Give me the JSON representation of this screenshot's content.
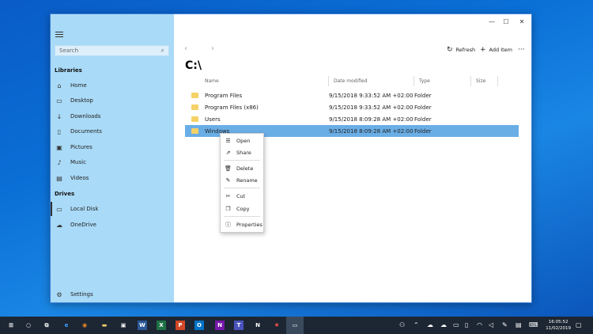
{
  "sidebar": {
    "search_placeholder": "Search",
    "libraries_title": "Libraries",
    "libraries": [
      {
        "label": "Home",
        "icon": "home-icon"
      },
      {
        "label": "Desktop",
        "icon": "desktop-icon"
      },
      {
        "label": "Downloads",
        "icon": "download-icon"
      },
      {
        "label": "Documents",
        "icon": "document-icon"
      },
      {
        "label": "Pictures",
        "icon": "pictures-icon"
      },
      {
        "label": "Music",
        "icon": "music-icon"
      },
      {
        "label": "Videos",
        "icon": "video-icon"
      }
    ],
    "drives_title": "Drives",
    "drives": [
      {
        "label": "Local Disk",
        "icon": "disk-icon"
      },
      {
        "label": "OneDrive",
        "icon": "cloud-icon"
      }
    ],
    "settings_label": "Settings"
  },
  "toolbar": {
    "refresh_label": "Refresh",
    "add_item_label": "Add Item"
  },
  "path": "C:\\",
  "columns": {
    "name": "Name",
    "date": "Date modified",
    "type": "Type",
    "size": "Size"
  },
  "files": [
    {
      "name": "Program Files",
      "date": "9/15/2018 9:33:52 AM +02:00",
      "type": "Folder"
    },
    {
      "name": "Program Files (x86)",
      "date": "9/15/2018 9:33:52 AM +02:00",
      "type": "Folder"
    },
    {
      "name": "Users",
      "date": "9/15/2018 8:09:28 AM +02:00",
      "type": "Folder"
    },
    {
      "name": "Windows",
      "date": "9/15/2018 8:09:28 AM +02:00",
      "type": "Folder"
    }
  ],
  "context_menu": {
    "open": "Open",
    "share": "Share",
    "delete": "Delete",
    "rename": "Rename",
    "cut": "Cut",
    "copy": "Copy",
    "properties": "Properties"
  },
  "taskbar": {
    "time": "16:05:52",
    "date": "11/02/2019"
  },
  "colors": {
    "sidebar": "#a9daf7",
    "selection": "#6aaee6",
    "taskbar": "#1d2633",
    "folder": "#f5d267"
  }
}
